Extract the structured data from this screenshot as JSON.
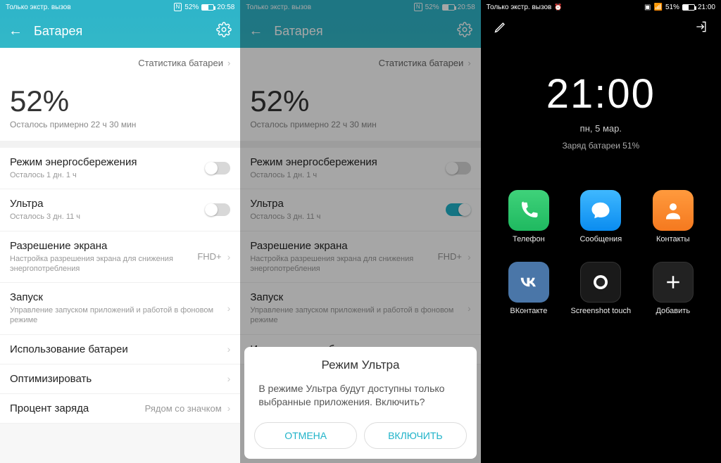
{
  "p1": {
    "status": {
      "carrier": "Только экстр. вызов",
      "pct": "52%",
      "time": "20:58",
      "nfc": "N"
    },
    "title": "Батарея",
    "stats_link": "Статистика батареи",
    "big_pct": "52%",
    "remaining": "Осталось примерно 22 ч 30 мин",
    "rows": {
      "power_save": {
        "title": "Режим энергосбережения",
        "sub": "Осталось 1 дн. 1 ч"
      },
      "ultra": {
        "title": "Ультра",
        "sub": "Осталось 3 дн. 11 ч"
      },
      "res": {
        "title": "Разрешение экрана",
        "sub": "Настройка разрешения экрана для снижения энергопотребления",
        "val": "FHD+"
      },
      "launch": {
        "title": "Запуск",
        "sub": "Управление запуском приложений и работой в фоновом режиме"
      },
      "usage": {
        "title": "Использование батареи"
      },
      "optimize": {
        "title": "Оптимизировать"
      },
      "pct_row": {
        "title": "Процент заряда",
        "val": "Рядом со значком"
      }
    }
  },
  "p2": {
    "status": {
      "carrier": "Только экстр. вызов",
      "pct": "52%",
      "time": "20:58",
      "nfc": "N"
    },
    "title": "Батарея",
    "stats_link": "Статистика батареи",
    "big_pct": "52%",
    "remaining": "Осталось примерно 22 ч 30 мин",
    "rows": {
      "power_save": {
        "title": "Режим энергосбережения",
        "sub": "Осталось 1 дн. 1 ч"
      },
      "ultra": {
        "title": "Ультра",
        "sub": "Осталось 3 дн. 11 ч"
      },
      "res": {
        "title": "Разрешение экрана",
        "sub": "Настройка разрешения экрана для снижения энергопотребления",
        "val": "FHD+"
      },
      "launch": {
        "title": "Запуск",
        "sub": "Управление запуском приложений и работой в фоновом режиме"
      },
      "usage": {
        "title": "Использование батареи"
      }
    },
    "sheet": {
      "title": "Режим Ультра",
      "body": "В режиме Ультра будут доступны только выбранные приложения. Включить?",
      "cancel": "ОТМЕНА",
      "ok": "ВКЛЮЧИТЬ"
    }
  },
  "p3": {
    "status": {
      "carrier": "Только экстр. вызов",
      "pct": "51%",
      "time": "21:00"
    },
    "clock": {
      "time": "21:00",
      "date": "пн, 5 мар.",
      "charge": "Заряд батареи 51%"
    },
    "apps": {
      "phone": "Телефон",
      "msg": "Сообщения",
      "contacts": "Контакты",
      "vk": "ВКонтакте",
      "scr": "Screenshot touch",
      "add": "Добавить"
    }
  }
}
